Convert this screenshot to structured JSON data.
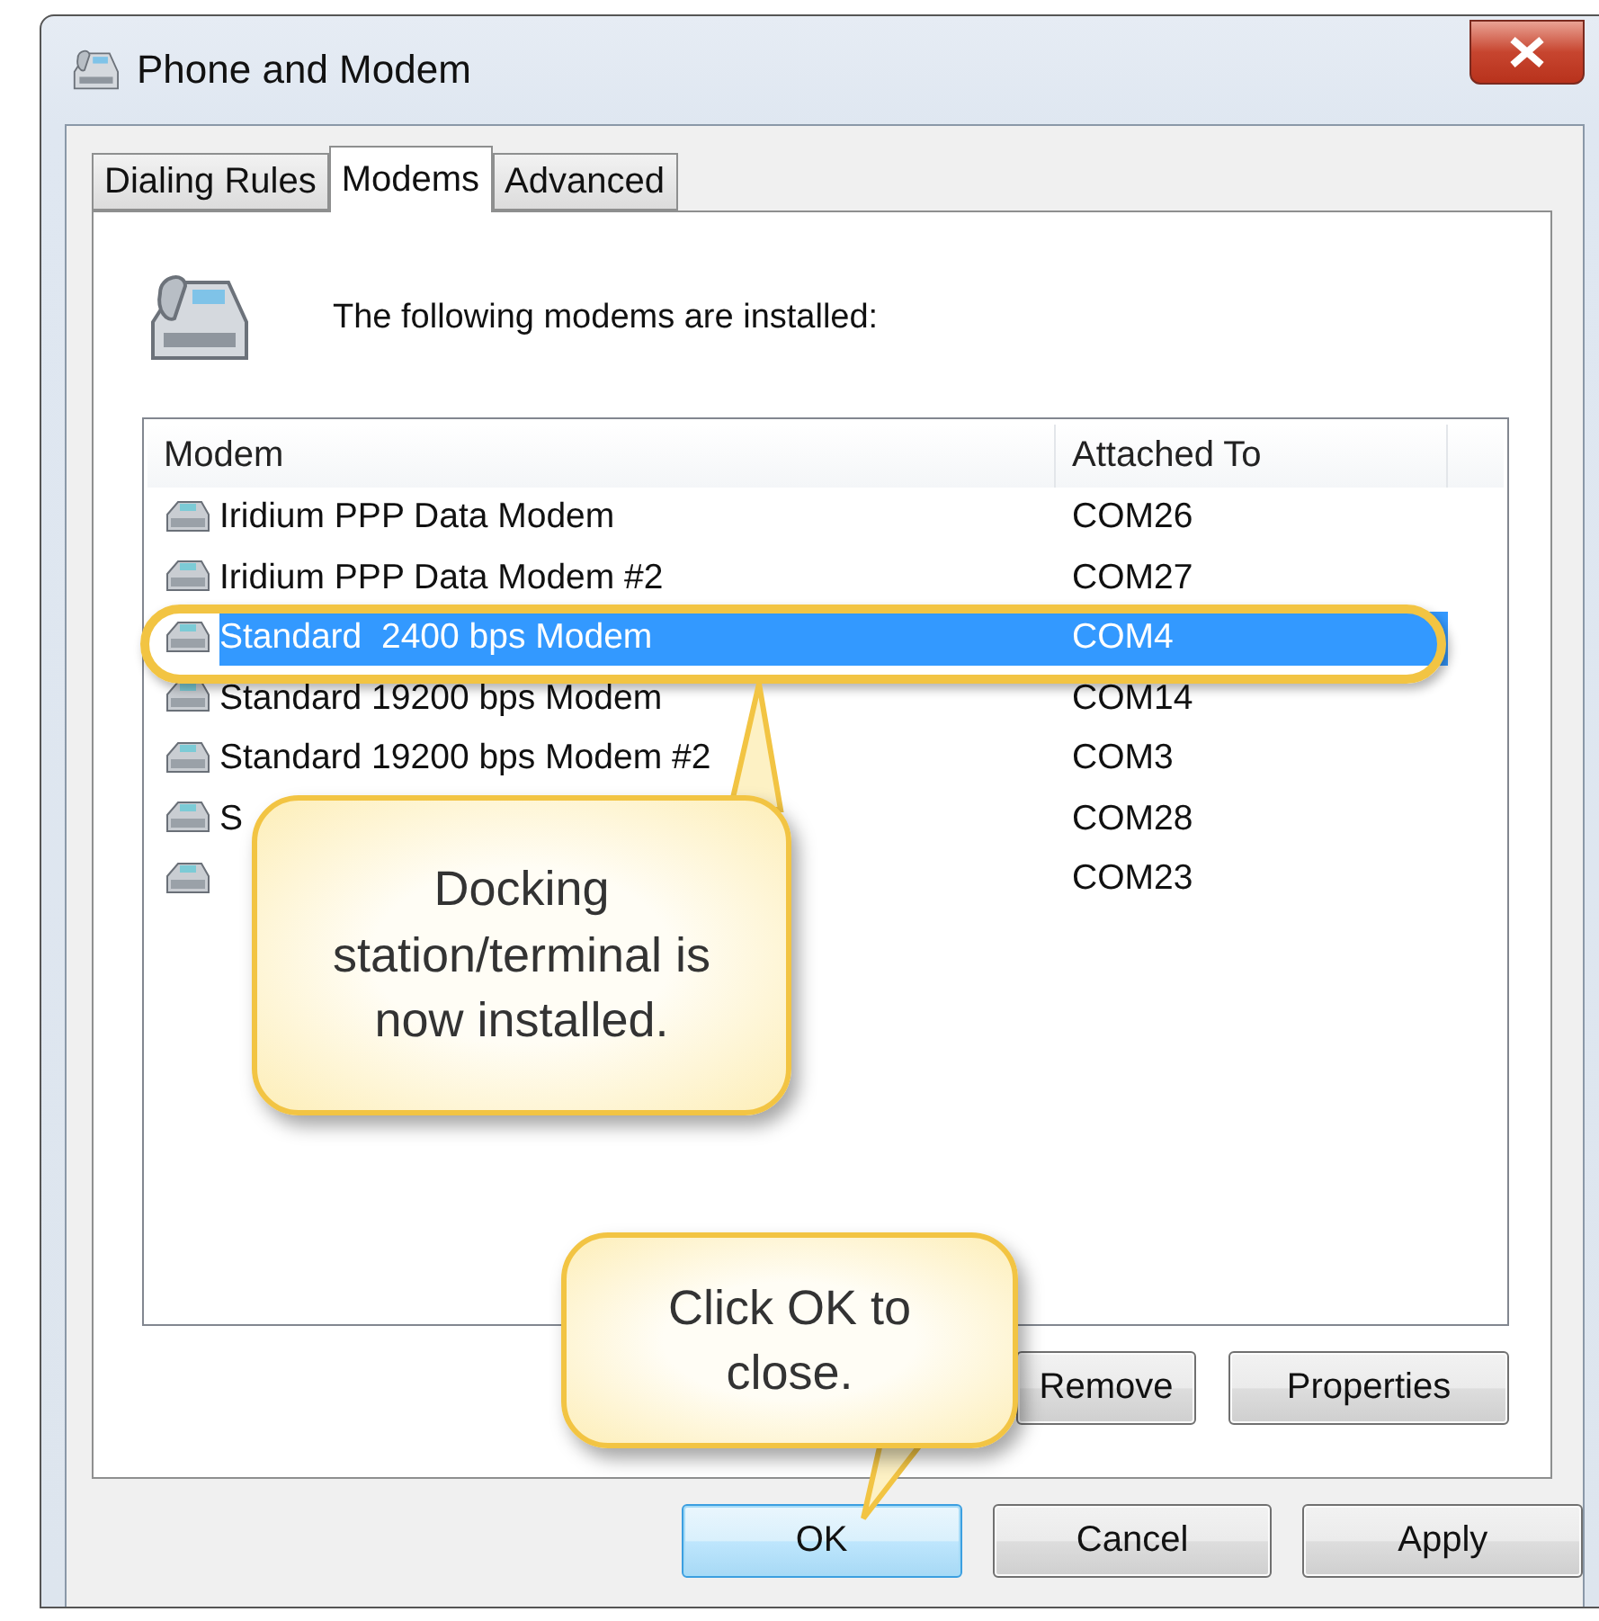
{
  "window": {
    "title": "Phone and Modem"
  },
  "tabs": [
    {
      "label": "Dialing Rules",
      "selected": false
    },
    {
      "label": "Modems",
      "selected": true
    },
    {
      "label": "Advanced",
      "selected": false
    }
  ],
  "intro": "The following modems are installed:",
  "table": {
    "columns": [
      "Modem",
      "Attached To"
    ],
    "rows": [
      {
        "name": "Iridium PPP Data Modem",
        "port": "COM26",
        "selected": false
      },
      {
        "name": "Iridium PPP Data Modem #2",
        "port": "COM27",
        "selected": false
      },
      {
        "name": "Standard  2400 bps Modem",
        "port": "COM4",
        "selected": true
      },
      {
        "name": "Standard 19200 bps Modem",
        "port": "COM14",
        "selected": false
      },
      {
        "name": "Standard 19200 bps Modem #2",
        "port": "COM3",
        "selected": false
      },
      {
        "name": "S",
        "port": "COM28",
        "selected": false
      },
      {
        "port": "COM23",
        "selected": false
      }
    ]
  },
  "list_buttons": [
    "Remove",
    "Properties"
  ],
  "buttons": [
    {
      "label": "OK",
      "selected": true
    },
    {
      "label": "Cancel",
      "selected": false
    },
    {
      "label": "Apply",
      "selected": false
    }
  ],
  "callouts": [
    {
      "text": "Docking station/terminal is now installed."
    },
    {
      "text": "Click OK to close."
    }
  ]
}
